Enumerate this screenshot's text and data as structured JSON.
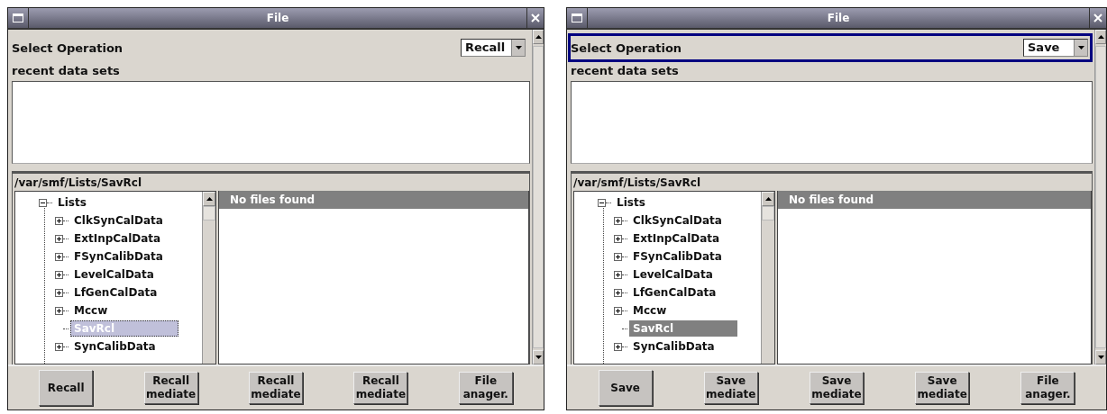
{
  "windows": [
    {
      "title": "File",
      "operation": {
        "label": "Select Operation",
        "value": "Recall",
        "focused": false
      },
      "recent": {
        "label": "recent data sets"
      },
      "path": "/var/smf/Lists/SavRcl",
      "tree": {
        "label": "Lists",
        "expanded": true,
        "children": [
          {
            "label": "ClkSynCalData",
            "expanded": false,
            "selected": false
          },
          {
            "label": "ExtInpCalData",
            "expanded": false,
            "selected": false
          },
          {
            "label": "FSynCalibData",
            "expanded": false,
            "selected": false
          },
          {
            "label": "LevelCalData",
            "expanded": false,
            "selected": false
          },
          {
            "label": "LfGenCalData",
            "expanded": false,
            "selected": false
          },
          {
            "label": "Mccw",
            "expanded": false,
            "selected": false
          },
          {
            "label": "SavRcl",
            "selected": true,
            "focused": true
          },
          {
            "label": "SynCalibData",
            "expanded": false,
            "selected": false
          }
        ]
      },
      "files": {
        "header": "No files found"
      },
      "buttons": [
        {
          "lines": [
            "Recall"
          ]
        },
        {
          "lines": [
            "Recall",
            "mediate"
          ]
        },
        {
          "lines": [
            "Recall",
            "mediate"
          ]
        },
        {
          "lines": [
            "Recall",
            "mediate"
          ]
        },
        {
          "lines": [
            "File",
            "anager."
          ]
        }
      ]
    },
    {
      "title": "File",
      "operation": {
        "label": "Select Operation",
        "value": "Save",
        "focused": true
      },
      "recent": {
        "label": "recent data sets"
      },
      "path": "/var/smf/Lists/SavRcl",
      "tree": {
        "label": "Lists",
        "expanded": true,
        "children": [
          {
            "label": "ClkSynCalData",
            "expanded": false,
            "selected": false
          },
          {
            "label": "ExtInpCalData",
            "expanded": false,
            "selected": false
          },
          {
            "label": "FSynCalibData",
            "expanded": false,
            "selected": false
          },
          {
            "label": "LevelCalData",
            "expanded": false,
            "selected": false
          },
          {
            "label": "LfGenCalData",
            "expanded": false,
            "selected": false
          },
          {
            "label": "Mccw",
            "expanded": false,
            "selected": false
          },
          {
            "label": "SavRcl",
            "selected": true,
            "focused": false
          },
          {
            "label": "SynCalibData",
            "expanded": false,
            "selected": false
          }
        ]
      },
      "files": {
        "header": "No files found"
      },
      "buttons": [
        {
          "lines": [
            "Save"
          ]
        },
        {
          "lines": [
            "Save",
            "mediate"
          ]
        },
        {
          "lines": [
            "Save",
            "mediate"
          ]
        },
        {
          "lines": [
            "Save",
            "mediate"
          ]
        },
        {
          "lines": [
            "File",
            "anager."
          ]
        }
      ]
    }
  ]
}
